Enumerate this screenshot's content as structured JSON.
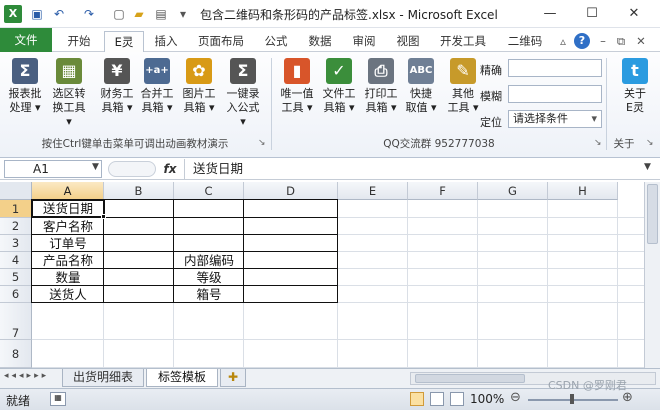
{
  "titlebar": {
    "title": "包含二维码和条形码的产品标签.xlsx - Microsoft Excel",
    "quick_access": [
      "save-icon",
      "undo-icon",
      "redo-icon",
      "new-icon",
      "open-icon",
      "print-preview-icon"
    ],
    "controls": {
      "minimize": "—",
      "maximize": "☐",
      "close": "✕"
    }
  },
  "tabs": [
    "文件",
    "开始",
    "E灵",
    "插入",
    "页面布局",
    "公式",
    "数据",
    "审阅",
    "视图",
    "开发工具",
    "二维码"
  ],
  "active_tab": "E灵",
  "ribbon": {
    "buttons": [
      {
        "l1": "报表批",
        "l2": "处理 ▾",
        "icon": "Σ",
        "color": "#4a5f80"
      },
      {
        "l1": "选区转",
        "l2": "换工具 ▾",
        "icon": "▦",
        "color": "#6a8a3a"
      },
      {
        "l1": "财务工",
        "l2": "具箱 ▾",
        "icon": "¥",
        "color": "#555555"
      },
      {
        "l1": "合并工",
        "l2": "具箱 ▾",
        "icon": "+a+",
        "color": "#4d6a92"
      },
      {
        "l1": "图片工",
        "l2": "具箱 ▾",
        "icon": "✿",
        "color": "#d89a16"
      },
      {
        "l1": "一键录",
        "l2": "入公式 ▾",
        "icon": "Σ",
        "color": "#555555"
      },
      {
        "l1": "唯一值",
        "l2": "工具 ▾",
        "icon": "▮",
        "color": "#d8552a"
      },
      {
        "l1": "文件工",
        "l2": "具箱 ▾",
        "icon": "✓",
        "color": "#3b8e3b"
      },
      {
        "l1": "打印工",
        "l2": "具箱 ▾",
        "icon": "⎙",
        "color": "#6b7480"
      },
      {
        "l1": "快捷",
        "l2": "取值 ▾",
        "icon": "ABC",
        "color": "#6f7f95"
      },
      {
        "l1": "其他",
        "l2": "工具 ▾",
        "icon": "✎",
        "color": "#c79a2a"
      },
      {
        "l1": "关于",
        "l2": "E灵",
        "icon": "t",
        "color": "#2b9be0"
      }
    ],
    "small_labels": {
      "exact": "精确",
      "fuzzy": "模糊",
      "locate": "定位"
    },
    "select_placeholder": "请选择条件",
    "group_label_1": "按住Ctrl键单击菜单可调出动画教材演示",
    "group_label_2": "QQ交流群  952777038",
    "group_label_3": "关于"
  },
  "formula_bar": {
    "name_box": "A1",
    "fx": "fx",
    "value": "送货日期"
  },
  "columns": [
    "A",
    "B",
    "C",
    "D",
    "E",
    "F",
    "G",
    "H"
  ],
  "rows": [
    "1",
    "2",
    "3",
    "4",
    "5",
    "6",
    "7",
    "8"
  ],
  "cells": {
    "A1": "送货日期",
    "A2": "客户名称",
    "A3": "订单号",
    "A4": "产品名称",
    "A5": "数量",
    "A6": "送货人",
    "C4": "内部编码",
    "C5": "等级",
    "C6": "箱号"
  },
  "sheets": [
    "出货明细表",
    "标签模板"
  ],
  "active_sheet": "标签模板",
  "statusbar": {
    "ready": "就绪",
    "zoom": "100%",
    "watermark": "CSDN @罗刚君"
  }
}
